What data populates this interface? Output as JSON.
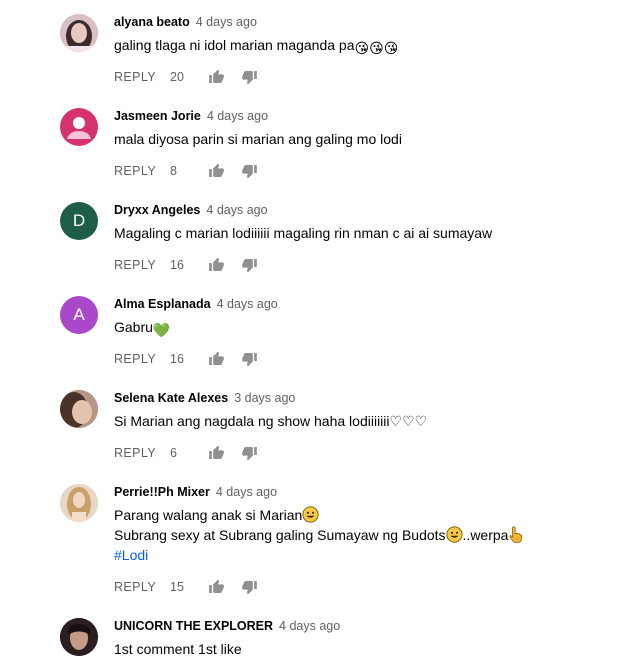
{
  "comments": [
    {
      "author": "alyana beato",
      "time": "4 days ago",
      "text": "galing tlaga ni idol marian maganda pa",
      "emoji": "😘😘😘",
      "reply_label": "REPLY",
      "likes": "20",
      "avatar": {
        "kind": "photo",
        "color": "#c8a2a8"
      }
    },
    {
      "author": "Jasmeen Jorie",
      "time": "4 days ago",
      "text": "mala diyosa parin si marian ang galing mo lodi",
      "reply_label": "REPLY",
      "likes": "8",
      "avatar": {
        "kind": "default-user",
        "color": "#d6336c"
      }
    },
    {
      "author": "Dryxx Angeles",
      "time": "4 days ago",
      "text": "Magaling c marian lodiiiiii magaling rin nman c ai ai sumayaw",
      "reply_label": "REPLY",
      "likes": "16",
      "avatar": {
        "kind": "letter",
        "letter": "D",
        "color": "#1e5e48"
      }
    },
    {
      "author": "Alma Esplanada",
      "time": "4 days ago",
      "text": "Gabru",
      "emoji": "💚",
      "reply_label": "REPLY",
      "likes": "16",
      "avatar": {
        "kind": "letter",
        "letter": "A",
        "color": "#a948c8"
      }
    },
    {
      "author": "Selena Kate Alexes",
      "time": "3 days ago",
      "text": "Si Marian ang nagdala ng show haha lodiiiiiii♡♡♡",
      "reply_label": "REPLY",
      "likes": "6",
      "avatar": {
        "kind": "photo",
        "color": "#8c6a5c"
      }
    },
    {
      "author": "Perrie!!Ph Mixer",
      "time": "4 days ago",
      "text_line1": "Parang walang anak si Marian",
      "text_line2": "Subrang sexy at Subrang galing Sumayaw ng Budots",
      "text_line2_tail": "..werpa",
      "hashtag": "#Lodi",
      "reply_label": "REPLY",
      "likes": "15",
      "avatar": {
        "kind": "photo",
        "color": "#d9b89a"
      }
    },
    {
      "author": "UNICORN THE EXPLORER",
      "time": "4 days ago",
      "text": "1st comment 1st like",
      "avatar": {
        "kind": "photo",
        "color": "#3a2c30"
      }
    }
  ]
}
